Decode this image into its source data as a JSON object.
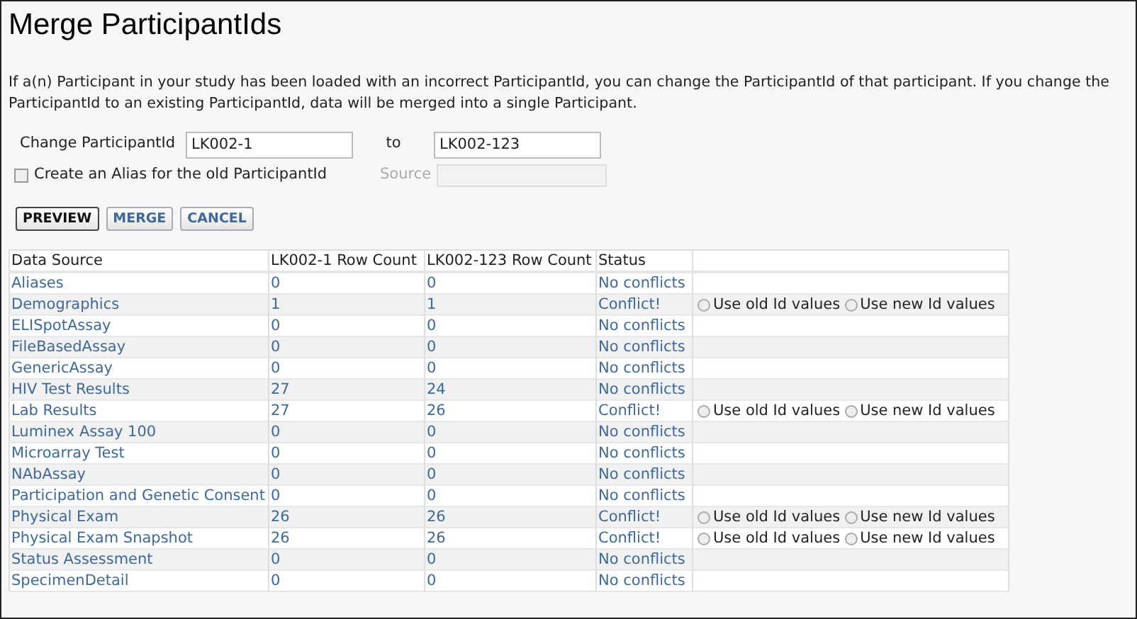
{
  "title": "Merge ParticipantIds",
  "intro": "If a(n) Participant in your study has been loaded with an incorrect ParticipantId, you can change the ParticipantId of that participant. If you change the ParticipantId to an existing ParticipantId, data will be merged into a single Participant.",
  "form": {
    "change_label": "Change ParticipantId",
    "old_id": "LK002-1",
    "to_label": "to",
    "new_id": "LK002-123",
    "alias_checkbox": {
      "label": "Create an Alias for the old ParticipantId",
      "checked": false
    },
    "source": {
      "label": "Source",
      "disabled": true
    }
  },
  "buttons": [
    {
      "label": "PREVIEW",
      "kind": "primary"
    },
    {
      "label": "MERGE",
      "kind": "secondary"
    },
    {
      "label": "CANCEL",
      "kind": "secondary"
    }
  ],
  "table": {
    "columns": [
      "Data Source",
      "LK002-1 Row Count",
      "LK002-123 Row Count",
      "Status"
    ],
    "rows": [
      {
        "source": "Aliases",
        "old_count": "0",
        "new_count": "0",
        "status": "No conflicts",
        "kind": "ok"
      },
      {
        "source": "Demographics",
        "old_count": "1",
        "new_count": "1",
        "status": "Conflict!",
        "kind": "conflict",
        "options": [
          {
            "label": "Use old Id values",
            "selected": false
          },
          {
            "label": "Use new Id values",
            "selected": false
          }
        ]
      },
      {
        "source": "ELISpotAssay",
        "old_count": "0",
        "new_count": "0",
        "status": "No conflicts",
        "kind": "ok"
      },
      {
        "source": "FileBasedAssay",
        "old_count": "0",
        "new_count": "0",
        "status": "No conflicts",
        "kind": "ok"
      },
      {
        "source": "GenericAssay",
        "old_count": "0",
        "new_count": "0",
        "status": "No conflicts",
        "kind": "ok"
      },
      {
        "source": "HIV Test Results",
        "old_count": "27",
        "new_count": "24",
        "status": "No conflicts",
        "kind": "ok"
      },
      {
        "source": "Lab Results",
        "old_count": "27",
        "new_count": "26",
        "status": "Conflict!",
        "kind": "conflict",
        "options": [
          {
            "label": "Use old Id values",
            "selected": false
          },
          {
            "label": "Use new Id values",
            "selected": false
          }
        ]
      },
      {
        "source": "Luminex Assay 100",
        "old_count": "0",
        "new_count": "0",
        "status": "No conflicts",
        "kind": "ok"
      },
      {
        "source": "Microarray Test",
        "old_count": "0",
        "new_count": "0",
        "status": "No conflicts",
        "kind": "ok"
      },
      {
        "source": "NAbAssay",
        "old_count": "0",
        "new_count": "0",
        "status": "No conflicts",
        "kind": "ok"
      },
      {
        "source": "Participation and Genetic Consent",
        "old_count": "0",
        "new_count": "0",
        "status": "No conflicts",
        "kind": "ok"
      },
      {
        "source": "Physical Exam",
        "old_count": "26",
        "new_count": "26",
        "status": "Conflict!",
        "kind": "conflict",
        "options": [
          {
            "label": "Use old Id values",
            "selected": false
          },
          {
            "label": "Use new Id values",
            "selected": false
          }
        ]
      },
      {
        "source": "Physical Exam Snapshot",
        "old_count": "26",
        "new_count": "26",
        "status": "Conflict!",
        "kind": "conflict",
        "options": [
          {
            "label": "Use old Id values",
            "selected": false
          },
          {
            "label": "Use new Id values",
            "selected": false
          }
        ]
      },
      {
        "source": "Status Assessment",
        "old_count": "0",
        "new_count": "0",
        "status": "No conflicts",
        "kind": "ok"
      },
      {
        "source": "SpecimenDetail",
        "old_count": "0",
        "new_count": "0",
        "status": "No conflicts",
        "kind": "ok"
      }
    ]
  }
}
